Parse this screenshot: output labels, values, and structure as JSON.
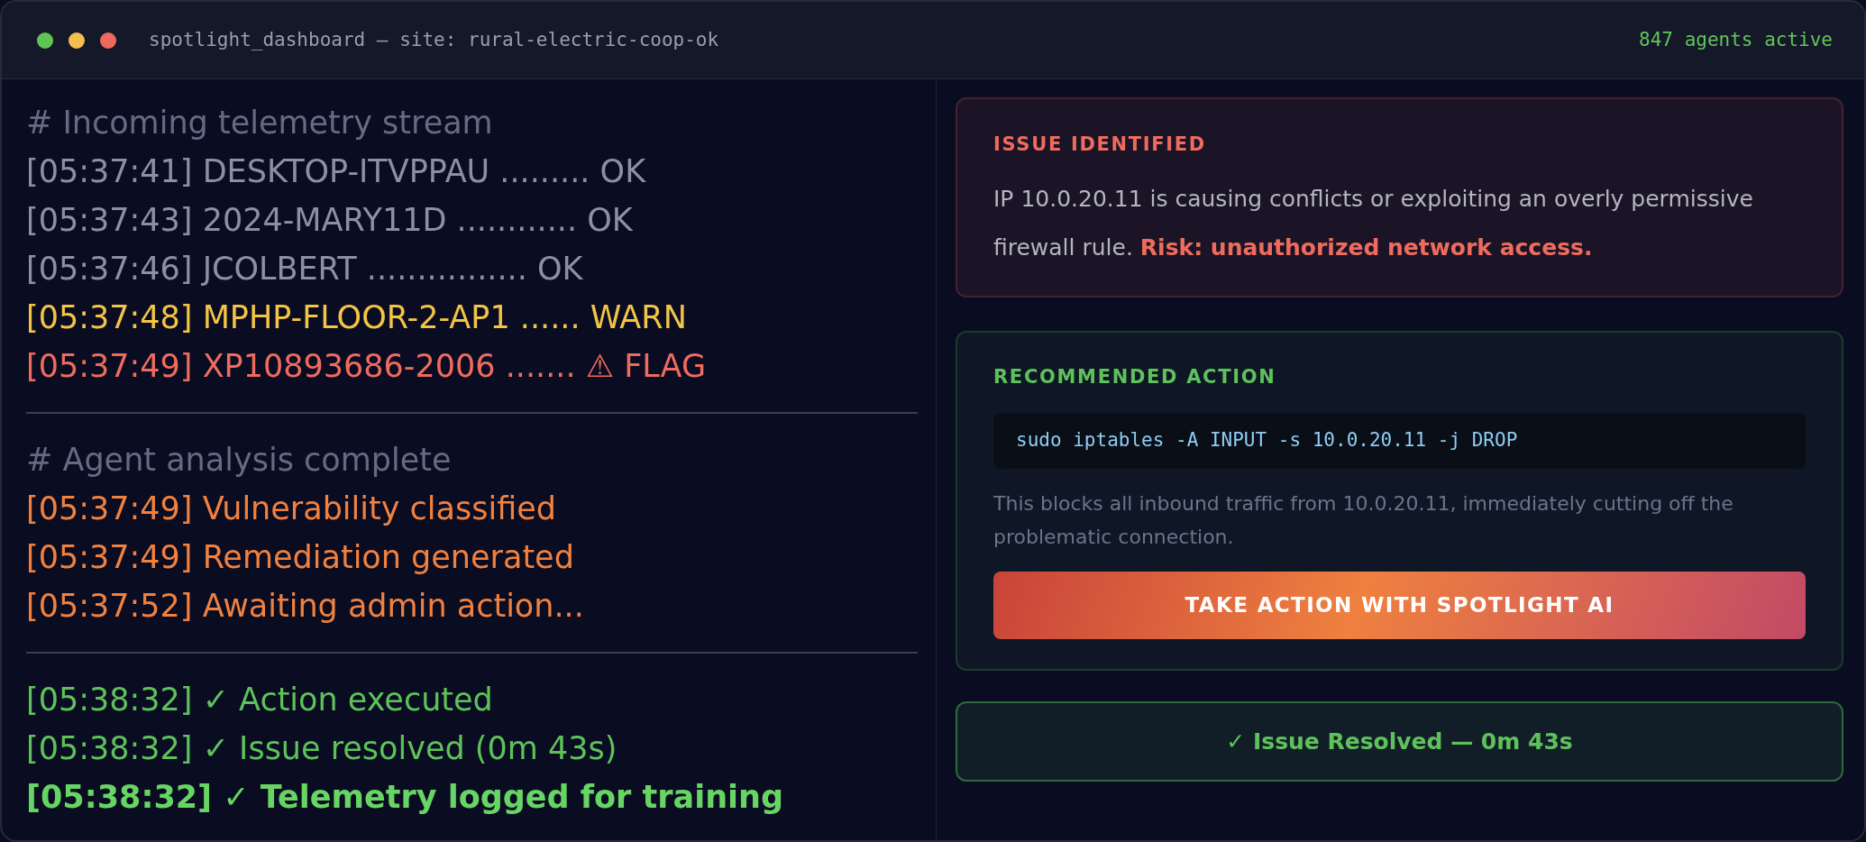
{
  "window": {
    "controls": [
      {
        "color": "#5fc454"
      },
      {
        "color": "#f5bf4f"
      },
      {
        "color": "#ef6a5e"
      }
    ],
    "title": "spotlight_dashboard — site: rural-electric-coop-ok",
    "status": "847 agents active"
  },
  "log": {
    "sections": [
      {
        "heading": "# Incoming telemetry stream",
        "lines": [
          {
            "kind": "ok",
            "text": "[05:37:41] DESKTOP-ITVPPAU ......... OK"
          },
          {
            "kind": "ok",
            "text": "[05:37:43] 2024-MARY11D ............ OK"
          },
          {
            "kind": "ok",
            "text": "[05:37:46] JCOLBERT ................ OK"
          },
          {
            "kind": "warn",
            "text": "[05:37:48] MPHP-FLOOR-2-AP1 ...... WARN"
          },
          {
            "kind": "flag",
            "text": "[05:37:49] XP10893686-2006 ....... ⚠ FLAG"
          }
        ]
      },
      {
        "heading": "# Agent analysis complete",
        "lines": [
          {
            "kind": "step",
            "text": "[05:37:49] Vulnerability classified"
          },
          {
            "kind": "step",
            "text": "[05:37:49] Remediation generated"
          },
          {
            "kind": "step",
            "text": "[05:37:52] Awaiting admin action..."
          }
        ]
      },
      {
        "lines": [
          {
            "kind": "done",
            "highlighted": false,
            "text": "[05:38:32] ✓ Action executed"
          },
          {
            "kind": "done",
            "highlighted": false,
            "text": "[05:38:32] ✓ Issue resolved (0m 43s)"
          },
          {
            "kind": "done",
            "highlighted": true,
            "text": "[05:38:32] ✓ Telemetry logged for training"
          }
        ]
      }
    ]
  },
  "issue_card": {
    "title": "ISSUE IDENTIFIED",
    "text": "IP 10.0.20.11 is causing conflicts or exploiting an overly permissive firewall rule. **Risk: unauthorized network access.**"
  },
  "action_card": {
    "title": "RECOMMENDED ACTION",
    "command": "sudo iptables -A INPUT -s 10.0.20.11 -j DROP",
    "note": "This blocks all inbound traffic from 10.0.20.11, immediately cutting off the problematic connection.",
    "button": "TAKE ACTION WITH SPOTLIGHT AI"
  },
  "resolved_banner": {
    "text": "✓ Issue Resolved — 0m 43s"
  }
}
